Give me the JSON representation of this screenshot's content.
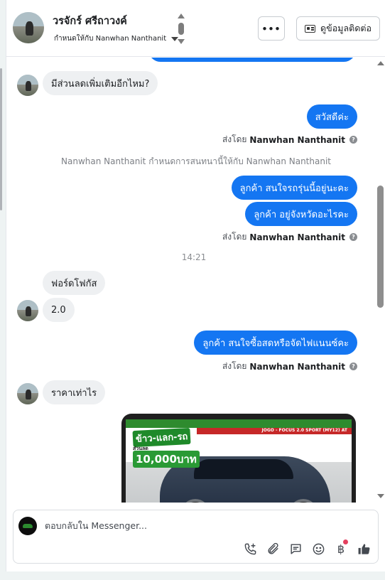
{
  "header": {
    "contact_name": "วรจักร์ ศรีถาวงค์",
    "assigned_text": "กำหนดให้กับ Nanwhan Nanthanit",
    "more_label": "•••",
    "contact_info_label": "ดูข้อมูลติดต่อ"
  },
  "messages": {
    "in_1": "มีส่วนลดเพิ่มเติมอีกไหม?",
    "out_1": "สวัสดีค่ะ",
    "sent_by_prefix": "ส่งโดย",
    "agent_name": "Nanwhan Nanthanit",
    "system_assign": "Nanwhan Nanthanit กำหนดการสนทนานี้ให้กับ Nanwhan Nanthanit",
    "out_2": "ลูกค้า สนใจรถรุ่นนี้อยู่นะคะ",
    "out_3": "ลูกค้า อยู่จังหวัดอะไรคะ",
    "time_divider": "14:21",
    "in_2": "ฟอร์ดโฟกัส",
    "in_3": "2.0",
    "out_4": "ลูกค้า สนใจซื้อสดหรือจัดไฟแนนซ์คะ",
    "in_4": "ราคาเท่าไร"
  },
  "photo": {
    "promo_top": "ข้าว-แลก-รถ",
    "promo_sub": "ส่วนลด",
    "promo_amount": "10,000บาท",
    "model_tag": "JOGO - FOCUS 2.0 SPORT (MY12) AT"
  },
  "composer": {
    "placeholder": "ตอบกลับใน Messenger..."
  },
  "colors": {
    "outgoing_bubble": "#1476f2",
    "incoming_bubble": "#eef0f2"
  }
}
